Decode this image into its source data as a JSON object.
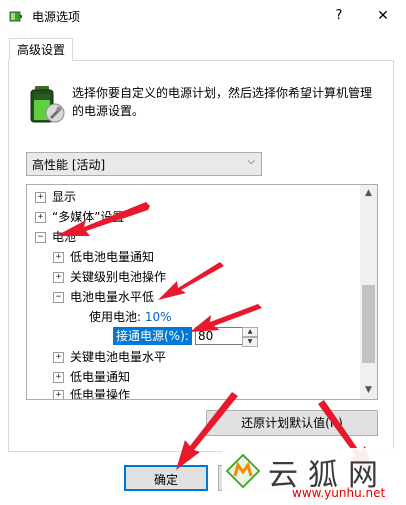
{
  "window": {
    "title": "电源选项",
    "help_label": "?",
    "close_label": "✕"
  },
  "tab": {
    "label": "高级设置"
  },
  "description": "选择你要自定义的电源计划，然后选择你希望计算机管理的电源设置。",
  "plan_select": {
    "value": "高性能 [活动]"
  },
  "tree": {
    "items": [
      {
        "expander": "+",
        "label": "显示"
      },
      {
        "expander": "+",
        "label": "“多媒体”设置"
      },
      {
        "expander": "−",
        "label": "电池"
      },
      {
        "expander": "+",
        "label": "低电池电量通知"
      },
      {
        "expander": "+",
        "label": "关键级别电池操作"
      },
      {
        "expander": "−",
        "label": "电池电量水平低"
      },
      {
        "label": "使用电池:",
        "value": "10%"
      },
      {
        "label": "接通电源(%):",
        "value": "80"
      },
      {
        "expander": "+",
        "label": "关键电池电量水平"
      },
      {
        "expander": "+",
        "label": "低电量通知"
      },
      {
        "expander": "+",
        "label": "低电量操作"
      }
    ]
  },
  "buttons": {
    "restore": "还原计划默认值(R)",
    "ok": "确定"
  },
  "watermark": {
    "name": "云狐网",
    "url": "www.yunhu.net"
  },
  "colors": {
    "accent": "#0078d7",
    "arrow": "#e8192c",
    "value_blue": "#0066cc"
  }
}
